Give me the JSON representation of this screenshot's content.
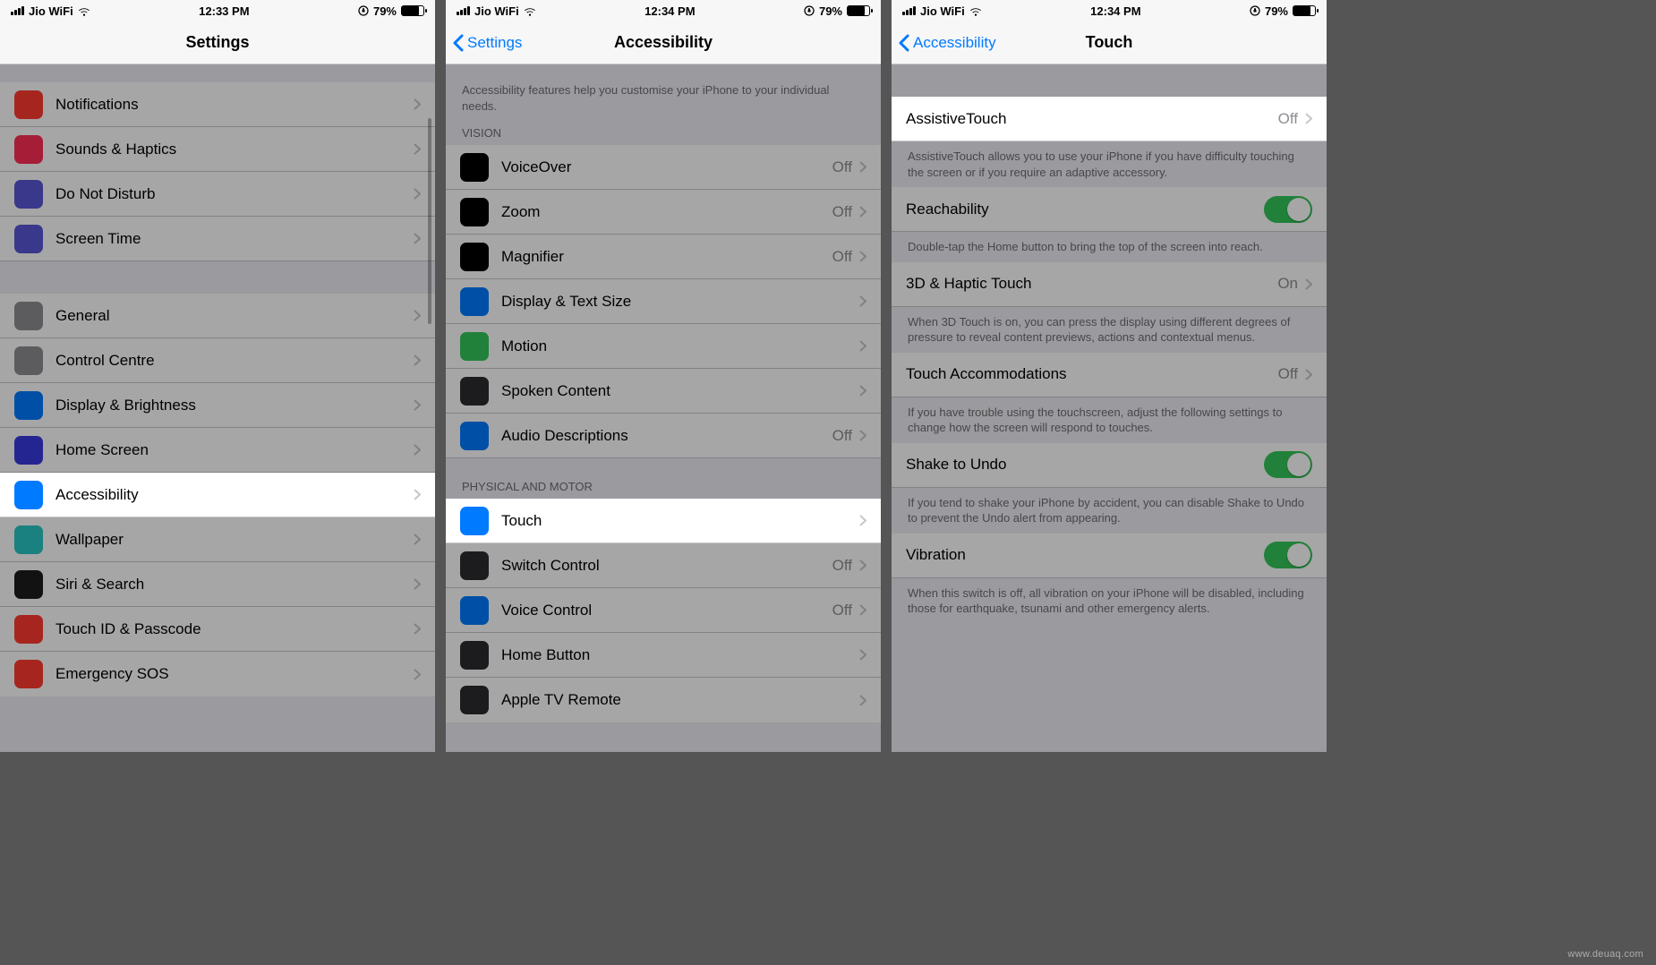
{
  "status": {
    "carrier": "Jio WiFi",
    "battery": "79%"
  },
  "times": {
    "s1": "12:33 PM",
    "s2": "12:34 PM",
    "s3": "12:34 PM"
  },
  "screen1": {
    "title": "Settings",
    "items": [
      {
        "label": "Notifications",
        "color": "#ff3b30"
      },
      {
        "label": "Sounds & Haptics",
        "color": "#ff2d55"
      },
      {
        "label": "Do Not Disturb",
        "color": "#5856d6"
      },
      {
        "label": "Screen Time",
        "color": "#5856d6"
      }
    ],
    "items2": [
      {
        "label": "General",
        "color": "#8e8e93"
      },
      {
        "label": "Control Centre",
        "color": "#8e8e93"
      },
      {
        "label": "Display & Brightness",
        "color": "#007aff"
      },
      {
        "label": "Home Screen",
        "color": "#3a3adf"
      },
      {
        "label": "Accessibility",
        "color": "#007aff",
        "highlight": true
      },
      {
        "label": "Wallpaper",
        "color": "#29c5c5"
      },
      {
        "label": "Siri & Search",
        "color": "#1c1c1e"
      },
      {
        "label": "Touch ID & Passcode",
        "color": "#ff3b30"
      },
      {
        "label": "Emergency SOS",
        "color": "#ff3b30"
      }
    ]
  },
  "screen2": {
    "back": "Settings",
    "title": "Accessibility",
    "intro": "Accessibility features help you customise your iPhone to your individual needs.",
    "sec1": "VISION",
    "vision": [
      {
        "label": "VoiceOver",
        "value": "Off",
        "color": "#000"
      },
      {
        "label": "Zoom",
        "value": "Off",
        "color": "#000"
      },
      {
        "label": "Magnifier",
        "value": "Off",
        "color": "#000"
      },
      {
        "label": "Display & Text Size",
        "color": "#007aff"
      },
      {
        "label": "Motion",
        "color": "#34c759"
      },
      {
        "label": "Spoken Content",
        "color": "#2c2c2e"
      },
      {
        "label": "Audio Descriptions",
        "value": "Off",
        "color": "#007aff"
      }
    ],
    "sec2": "PHYSICAL AND MOTOR",
    "motor": [
      {
        "label": "Touch",
        "color": "#007aff",
        "highlight": true
      },
      {
        "label": "Switch Control",
        "value": "Off",
        "color": "#2c2c2e"
      },
      {
        "label": "Voice Control",
        "value": "Off",
        "color": "#007aff"
      },
      {
        "label": "Home Button",
        "color": "#2c2c2e"
      },
      {
        "label": "Apple TV Remote",
        "color": "#2c2c2e"
      }
    ]
  },
  "screen3": {
    "back": "Accessibility",
    "title": "Touch",
    "rows": {
      "assistive": {
        "label": "AssistiveTouch",
        "value": "Off"
      },
      "assistive_foot": "AssistiveTouch allows you to use your iPhone if you have difficulty touching the screen or if you require an adaptive accessory.",
      "reach": {
        "label": "Reachability"
      },
      "reach_foot": "Double-tap the Home button to bring the top of the screen into reach.",
      "haptic": {
        "label": "3D & Haptic Touch",
        "value": "On"
      },
      "haptic_foot": "When 3D Touch is on, you can press the display using different degrees of pressure to reveal content previews, actions and contextual menus.",
      "accom": {
        "label": "Touch Accommodations",
        "value": "Off"
      },
      "accom_foot": "If you have trouble using the touchscreen, adjust the following settings to change how the screen will respond to touches.",
      "shake": {
        "label": "Shake to Undo"
      },
      "shake_foot": "If you tend to shake your iPhone by accident, you can disable Shake to Undo to prevent the Undo alert from appearing.",
      "vib": {
        "label": "Vibration"
      },
      "vib_foot": "When this switch is off, all vibration on your iPhone will be disabled, including those for earthquake, tsunami and other emergency alerts."
    }
  },
  "watermark": "www.deuaq.com"
}
